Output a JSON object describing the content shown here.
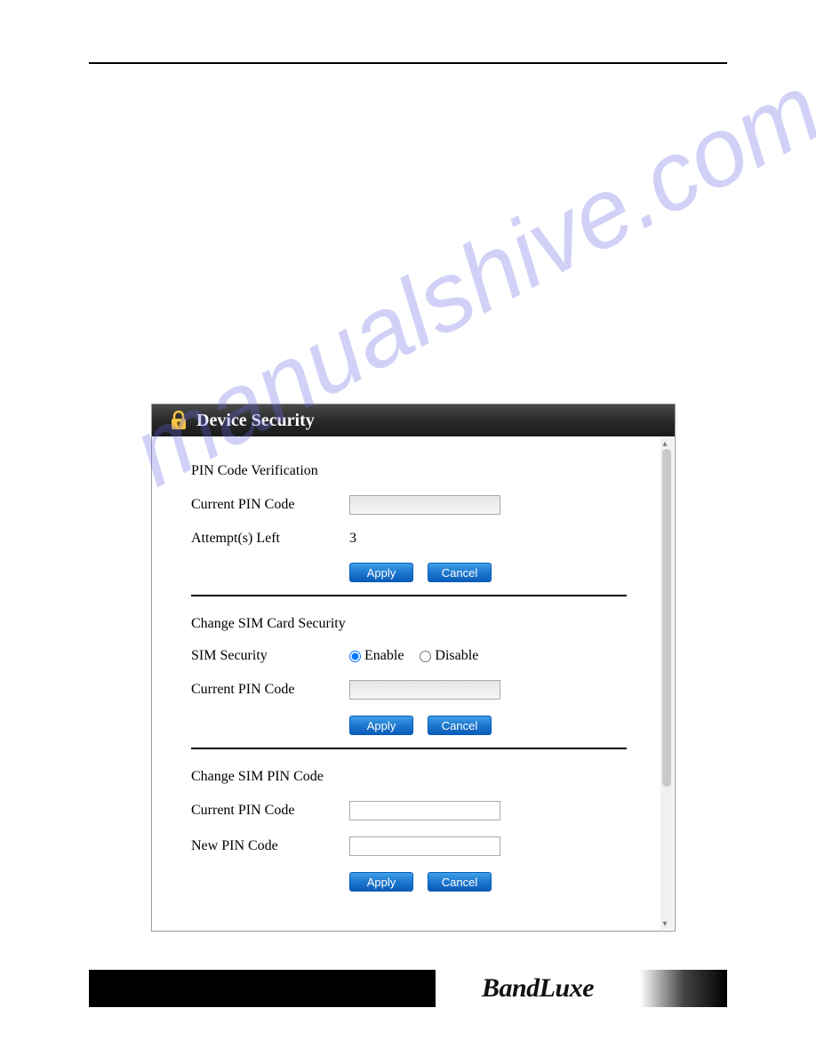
{
  "watermark": "manualshive.com",
  "panel": {
    "title": "Device Security",
    "section1": {
      "heading": "PIN Code Verification",
      "current_pin_label": "Current PIN Code",
      "current_pin_value": "",
      "attempts_label": "Attempt(s) Left",
      "attempts_value": "3",
      "apply": "Apply",
      "cancel": "Cancel"
    },
    "section2": {
      "heading": "Change SIM Card Security",
      "sim_security_label": "SIM Security",
      "enable_label": "Enable",
      "disable_label": "Disable",
      "current_pin_label": "Current PIN Code",
      "current_pin_value": "",
      "apply": "Apply",
      "cancel": "Cancel"
    },
    "section3": {
      "heading": "Change SIM PIN Code",
      "current_pin_label": "Current PIN Code",
      "current_pin_value": "",
      "new_pin_label": "New PIN Code",
      "new_pin_value": "",
      "apply": "Apply",
      "cancel": "Cancel"
    }
  },
  "footer": {
    "brand": "BandLuxe"
  }
}
